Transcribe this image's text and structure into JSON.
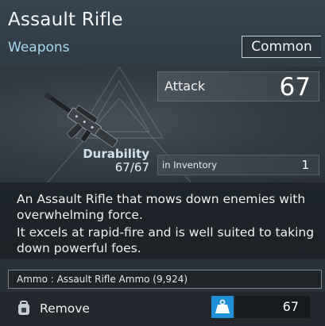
{
  "item": {
    "name": "Assault Rifle",
    "category": "Weapons",
    "rarity": "Common"
  },
  "stats": {
    "attack_label": "Attack",
    "attack_value": "67",
    "durability_label": "Durability",
    "durability_value": "67/67",
    "inventory_label": "in Inventory",
    "inventory_value": "1"
  },
  "description": {
    "lines": [
      "An Assault Rifle that mows down enemies with",
      "overwhelming force.",
      "It excels at rapid-fire and is well suited to taking",
      "down powerful foes."
    ]
  },
  "ammo": {
    "text": "Ammo : Assault Rifle Ammo (9,924)"
  },
  "footer": {
    "remove_label": "Remove",
    "weight_value": "67"
  },
  "icons": {
    "item_image": "assault-rifle-icon",
    "remove": "backpack-remove-icon",
    "weight": "weight-icon"
  },
  "colors": {
    "category": "#a9d6ea",
    "weight_badge": "#1f90d6"
  }
}
